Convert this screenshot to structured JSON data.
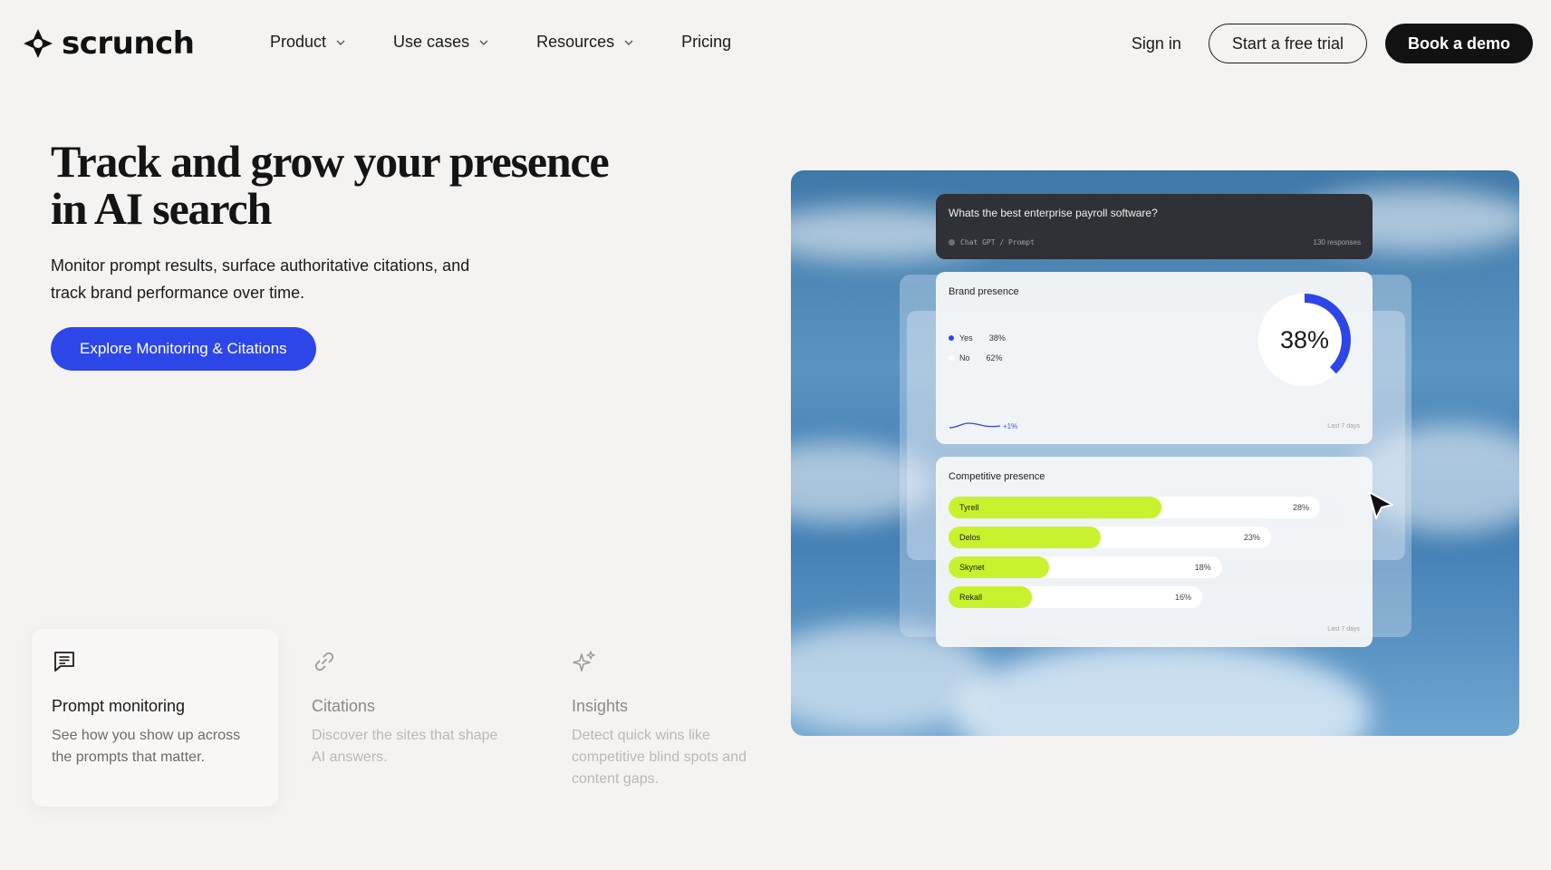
{
  "nav": {
    "logo_text": "scrunch",
    "links": [
      {
        "label": "Product",
        "has_dropdown": true
      },
      {
        "label": "Use cases",
        "has_dropdown": true
      },
      {
        "label": "Resources",
        "has_dropdown": true
      },
      {
        "label": "Pricing",
        "has_dropdown": false
      }
    ],
    "sign_in": "Sign in",
    "trial_button": "Start a free trial",
    "demo_button": "Book a demo"
  },
  "hero": {
    "title_line1": "Track and grow your presence",
    "title_line2": "in AI search",
    "subtitle_line1": "Monitor prompt results, surface authoritative citations, and",
    "subtitle_line2": "track brand performance over time.",
    "cta": "Explore Monitoring & Citations"
  },
  "features": [
    {
      "icon": "chat-lines-icon",
      "title": "Prompt monitoring",
      "desc_line1": "See how you show up across",
      "desc_line2": "the prompts that matter.",
      "desc_line3": "",
      "active": true
    },
    {
      "icon": "link-icon",
      "title": "Citations",
      "desc_line1": "Discover the sites that shape",
      "desc_line2": "AI answers.",
      "desc_line3": "",
      "active": false
    },
    {
      "icon": "sparkle-icon",
      "title": "Insights",
      "desc_line1": "Detect quick wins like",
      "desc_line2": "competitive blind spots and",
      "desc_line3": "content gaps.",
      "active": false
    }
  ],
  "dashboard": {
    "prompt": {
      "question": "Whats the best enterprise payroll software?",
      "source": "Chat GPT / Prompt",
      "responses": "130 responses"
    },
    "brand_presence": {
      "title": "Brand presence",
      "yes_label": "Yes",
      "yes_value": "38%",
      "no_label": "No",
      "no_value": "62%",
      "donut_percent": 38,
      "donut_label": "38%",
      "trend": "+1%",
      "period": "Last 7 days"
    },
    "competitive_presence": {
      "title": "Competitive presence",
      "period": "Last 7 days",
      "competitors": [
        {
          "name": "Tyrell",
          "value": 28,
          "label": "28%"
        },
        {
          "name": "Delos",
          "value": 23,
          "label": "23%"
        },
        {
          "name": "Skynet",
          "value": 18,
          "label": "18%"
        },
        {
          "name": "Rekall",
          "value": 16,
          "label": "16%"
        }
      ]
    }
  },
  "colors": {
    "background": "#f5f3f2",
    "primary": "#2c46e8",
    "dark": "#121212",
    "accent_lime": "#c8f22d",
    "donut_blue": "#2c46e8"
  }
}
